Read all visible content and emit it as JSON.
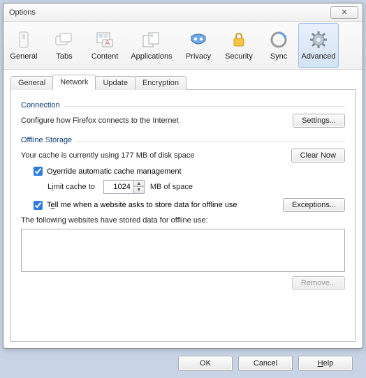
{
  "window": {
    "title": "Options",
    "close_symbol": "✕"
  },
  "toolbar": {
    "items": [
      {
        "label": "General"
      },
      {
        "label": "Tabs"
      },
      {
        "label": "Content"
      },
      {
        "label": "Applications"
      },
      {
        "label": "Privacy"
      },
      {
        "label": "Security"
      },
      {
        "label": "Sync"
      },
      {
        "label": "Advanced"
      }
    ]
  },
  "tabs": {
    "items": [
      {
        "label": "General"
      },
      {
        "label": "Network"
      },
      {
        "label": "Update"
      },
      {
        "label": "Encryption"
      }
    ]
  },
  "network": {
    "connection": {
      "heading": "Connection",
      "desc": "Configure how Firefox connects to the Internet",
      "settings_btn": "Settings..."
    },
    "offline": {
      "heading": "Offline Storage",
      "cache_desc": "Your cache is currently using 177 MB of disk space",
      "clear_btn": "Clear Now",
      "override_label_pre": "O",
      "override_label_u": "v",
      "override_label_post": "erride automatic cache management",
      "limit_pre": "L",
      "limit_u": "i",
      "limit_post": "mit cache to",
      "limit_value": "1024",
      "limit_unit": "MB of space",
      "tell_pre": "T",
      "tell_u": "e",
      "tell_post": "ll me when a website asks to store data for offline use",
      "exceptions_btn": "Exceptions...",
      "stored_label": "The following websites have stored data for offline use:",
      "remove_btn": "Remove..."
    }
  },
  "footer": {
    "ok": "OK",
    "cancel": "Cancel",
    "help_u": "H",
    "help_post": "elp"
  }
}
